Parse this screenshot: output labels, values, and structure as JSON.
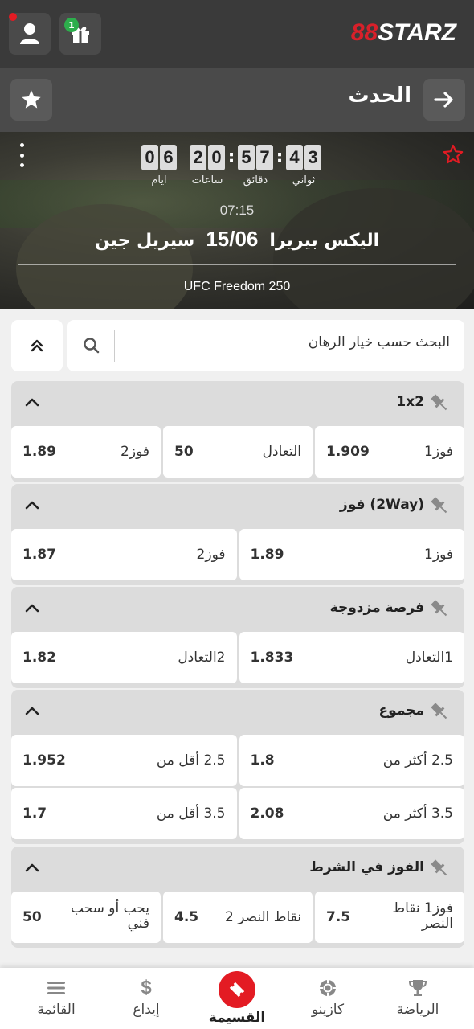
{
  "header": {
    "logo_accent": "88",
    "logo_text": "STARZ",
    "gift_badge": "1",
    "icons": [
      "user-icon",
      "gift-icon"
    ]
  },
  "titlebar": {
    "title": "الحدث",
    "icons": [
      "star-icon",
      "arrow-right-icon"
    ]
  },
  "event": {
    "countdown": {
      "days": "06",
      "hours": "20",
      "minutes": "57",
      "seconds": "43",
      "days_label": "ايام",
      "hours_label": "ساعات",
      "minutes_label": "دقائق",
      "seconds_label": "ثواني"
    },
    "time": "07:15",
    "team1": "اليكس بيريرا",
    "date": "15/06",
    "team2": "سيريل جين",
    "league": "UFC Freedom 250"
  },
  "search": {
    "placeholder": "البحث حسب خيار الرهان"
  },
  "markets": [
    {
      "title": "1x2",
      "rows": [
        [
          {
            "label": "فوز1",
            "value": "1.909"
          },
          {
            "label": "التعادل",
            "value": "50"
          },
          {
            "label": "فوز2",
            "value": "1.89"
          }
        ]
      ]
    },
    {
      "title": "فوز (2Way)",
      "rows": [
        [
          {
            "label": "فوز1",
            "value": "1.89"
          },
          {
            "label": "فوز2",
            "value": "1.87"
          }
        ]
      ]
    },
    {
      "title": "فرصة مزدوجة",
      "rows": [
        [
          {
            "label": "1التعادل",
            "value": "1.833"
          },
          {
            "label": "2التعادل",
            "value": "1.82"
          }
        ]
      ]
    },
    {
      "title": "مجموع",
      "rows": [
        [
          {
            "label": "2.5 أكثر من",
            "value": "1.8"
          },
          {
            "label": "2.5 أقل من",
            "value": "1.952"
          }
        ],
        [
          {
            "label": "3.5 أكثر من",
            "value": "2.08"
          },
          {
            "label": "3.5 أقل من",
            "value": "1.7"
          }
        ]
      ]
    },
    {
      "title": "الفوز في الشرط",
      "rows": [
        [
          {
            "label": "فوز1 نقاط النصر",
            "value": "7.5"
          },
          {
            "label": "نقاط النصر 2",
            "value": "4.5"
          },
          {
            "label": "يحب أو سحب فني",
            "value": "50"
          }
        ]
      ]
    }
  ],
  "bottom_nav": [
    {
      "label": "الرياضة",
      "icon": "trophy-icon"
    },
    {
      "label": "كازينو",
      "icon": "casino-chip-icon"
    },
    {
      "label": "القسيمة",
      "icon": "ticket-icon"
    },
    {
      "label": "إيداع",
      "icon": "dollar-icon"
    },
    {
      "label": "القائمة",
      "icon": "menu-icon"
    }
  ],
  "colors": {
    "brand_red": "#e31b23",
    "topbar": "#3a3a3a",
    "titlebar": "#4a4a4a",
    "badge_green": "#2dae4c"
  }
}
